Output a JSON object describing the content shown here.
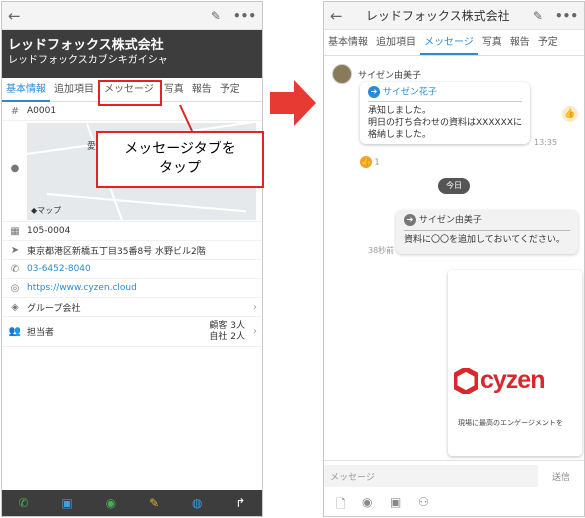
{
  "left": {
    "company": "レッドフォックス株式会社",
    "kana": "レッドフォックスカブシキガイシャ",
    "tabs": [
      "基本情報",
      "追加項目",
      "メッセージ",
      "写真",
      "報告",
      "予定"
    ],
    "code": "A0001",
    "map_place": "愛宕",
    "map_brand": "マップ",
    "postal": "105-0004",
    "address": "東京都港区新橋五丁目35番8号 水野ビル2階",
    "phone": "03-6452-8040",
    "url": "https://www.cyzen.cloud",
    "group": "グループ会社",
    "staff_label": "担当者",
    "staff_client": "顧客 3人",
    "staff_internal": "自社 2人",
    "callout_line1": "メッセージタブを",
    "callout_line2": "タップ"
  },
  "right": {
    "company": "レッドフォックス株式会社",
    "tabs": [
      "基本情報",
      "追加項目",
      "メッセージ",
      "写真",
      "報告",
      "予定"
    ],
    "sender": "サイゼン由美子",
    "reply_to": "サイゼン花子",
    "msg1_line1": "承知しました。",
    "msg1_line2": "明日の打ち合わせの資料はXXXXXXに",
    "msg1_line3": "格納しました。",
    "msg1_time": "13:35",
    "reaction_count": "1",
    "date_chip": "今日",
    "mine_reply_to": "サイゼン由美子",
    "mine_text": "資料に〇〇を追加しておいてください。",
    "mine_time": "38秒前",
    "image_logo": "cyzen",
    "image_sub": "現場に最高のエンゲージメントを",
    "input_placeholder": "メッセージ",
    "send_label": "送信"
  },
  "colors": {
    "accent": "#2b8ad3",
    "highlight": "#e02424",
    "header_dark": "#3d3d3d",
    "brand_red": "#d8282e"
  }
}
